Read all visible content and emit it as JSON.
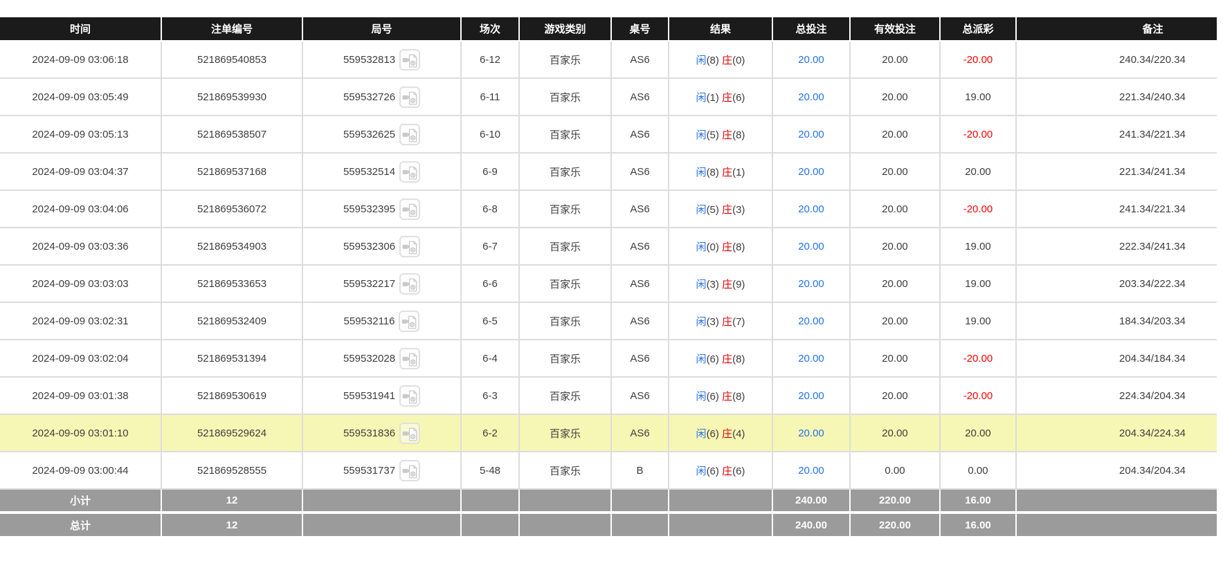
{
  "table": {
    "columns": [
      {
        "label": "时间"
      },
      {
        "label": "注单编号"
      },
      {
        "label": "局号"
      },
      {
        "label": "场次"
      },
      {
        "label": "游戏类别"
      },
      {
        "label": "桌号"
      },
      {
        "label": "结果"
      },
      {
        "label": "总投注"
      },
      {
        "label": "有效投注"
      },
      {
        "label": "总派彩"
      },
      {
        "label": "备注"
      }
    ],
    "rows": [
      {
        "time": "2024-09-09 03:06:18",
        "bet_id": "521869540853",
        "round_id": "559532813",
        "session": "6-12",
        "game": "百家乐",
        "table_no": "AS6",
        "player": "闲",
        "player_val": "(8)",
        "banker": "庄",
        "banker_val": "(0)",
        "total_bet": "20.00",
        "valid_bet": "20.00",
        "payout": "-20.00",
        "payout_neg": true,
        "remark": "240.34/220.34",
        "highlighted": false
      },
      {
        "time": "2024-09-09 03:05:49",
        "bet_id": "521869539930",
        "round_id": "559532726",
        "session": "6-11",
        "game": "百家乐",
        "table_no": "AS6",
        "player": "闲",
        "player_val": "(1)",
        "banker": "庄",
        "banker_val": "(6)",
        "total_bet": "20.00",
        "valid_bet": "20.00",
        "payout": "19.00",
        "payout_neg": false,
        "remark": "221.34/240.34",
        "highlighted": false
      },
      {
        "time": "2024-09-09 03:05:13",
        "bet_id": "521869538507",
        "round_id": "559532625",
        "session": "6-10",
        "game": "百家乐",
        "table_no": "AS6",
        "player": "闲",
        "player_val": "(5)",
        "banker": "庄",
        "banker_val": "(8)",
        "total_bet": "20.00",
        "valid_bet": "20.00",
        "payout": "-20.00",
        "payout_neg": true,
        "remark": "241.34/221.34",
        "highlighted": false
      },
      {
        "time": "2024-09-09 03:04:37",
        "bet_id": "521869537168",
        "round_id": "559532514",
        "session": "6-9",
        "game": "百家乐",
        "table_no": "AS6",
        "player": "闲",
        "player_val": "(8)",
        "banker": "庄",
        "banker_val": "(1)",
        "total_bet": "20.00",
        "valid_bet": "20.00",
        "payout": "20.00",
        "payout_neg": false,
        "remark": "221.34/241.34",
        "highlighted": false
      },
      {
        "time": "2024-09-09 03:04:06",
        "bet_id": "521869536072",
        "round_id": "559532395",
        "session": "6-8",
        "game": "百家乐",
        "table_no": "AS6",
        "player": "闲",
        "player_val": "(5)",
        "banker": "庄",
        "banker_val": "(3)",
        "total_bet": "20.00",
        "valid_bet": "20.00",
        "payout": "-20.00",
        "payout_neg": true,
        "remark": "241.34/221.34",
        "highlighted": false
      },
      {
        "time": "2024-09-09 03:03:36",
        "bet_id": "521869534903",
        "round_id": "559532306",
        "session": "6-7",
        "game": "百家乐",
        "table_no": "AS6",
        "player": "闲",
        "player_val": "(0)",
        "banker": "庄",
        "banker_val": "(8)",
        "total_bet": "20.00",
        "valid_bet": "20.00",
        "payout": "19.00",
        "payout_neg": false,
        "remark": "222.34/241.34",
        "highlighted": false
      },
      {
        "time": "2024-09-09 03:03:03",
        "bet_id": "521869533653",
        "round_id": "559532217",
        "session": "6-6",
        "game": "百家乐",
        "table_no": "AS6",
        "player": "闲",
        "player_val": "(3)",
        "banker": "庄",
        "banker_val": "(9)",
        "total_bet": "20.00",
        "valid_bet": "20.00",
        "payout": "19.00",
        "payout_neg": false,
        "remark": "203.34/222.34",
        "highlighted": false
      },
      {
        "time": "2024-09-09 03:02:31",
        "bet_id": "521869532409",
        "round_id": "559532116",
        "session": "6-5",
        "game": "百家乐",
        "table_no": "AS6",
        "player": "闲",
        "player_val": "(3)",
        "banker": "庄",
        "banker_val": "(7)",
        "total_bet": "20.00",
        "valid_bet": "20.00",
        "payout": "19.00",
        "payout_neg": false,
        "remark": "184.34/203.34",
        "highlighted": false
      },
      {
        "time": "2024-09-09 03:02:04",
        "bet_id": "521869531394",
        "round_id": "559532028",
        "session": "6-4",
        "game": "百家乐",
        "table_no": "AS6",
        "player": "闲",
        "player_val": "(6)",
        "banker": "庄",
        "banker_val": "(8)",
        "total_bet": "20.00",
        "valid_bet": "20.00",
        "payout": "-20.00",
        "payout_neg": true,
        "remark": "204.34/184.34",
        "highlighted": false
      },
      {
        "time": "2024-09-09 03:01:38",
        "bet_id": "521869530619",
        "round_id": "559531941",
        "session": "6-3",
        "game": "百家乐",
        "table_no": "AS6",
        "player": "闲",
        "player_val": "(6)",
        "banker": "庄",
        "banker_val": "(8)",
        "total_bet": "20.00",
        "valid_bet": "20.00",
        "payout": "-20.00",
        "payout_neg": true,
        "remark": "224.34/204.34",
        "highlighted": false
      },
      {
        "time": "2024-09-09 03:01:10",
        "bet_id": "521869529624",
        "round_id": "559531836",
        "session": "6-2",
        "game": "百家乐",
        "table_no": "AS6",
        "player": "闲",
        "player_val": "(6)",
        "banker": "庄",
        "banker_val": "(4)",
        "total_bet": "20.00",
        "valid_bet": "20.00",
        "payout": "20.00",
        "payout_neg": false,
        "remark": "204.34/224.34",
        "highlighted": true
      },
      {
        "time": "2024-09-09 03:00:44",
        "bet_id": "521869528555",
        "round_id": "559531737",
        "session": "5-48",
        "game": "百家乐",
        "table_no": "B",
        "player": "闲",
        "player_val": "(6)",
        "banker": "庄",
        "banker_val": "(6)",
        "total_bet": "20.00",
        "valid_bet": "0.00",
        "payout": "0.00",
        "payout_neg": false,
        "remark": "204.34/204.34",
        "highlighted": false
      }
    ],
    "subtotal": {
      "label": "小计",
      "count": "12",
      "total_bet": "240.00",
      "valid_bet": "220.00",
      "payout": "16.00"
    },
    "total": {
      "label": "总计",
      "count": "12",
      "total_bet": "240.00",
      "valid_bet": "220.00",
      "payout": "16.00"
    }
  },
  "icons": {
    "video_replay": "video-film-document"
  },
  "colors": {
    "header_bg": "#1b1b1b",
    "row_highlight": "#f7f7b5",
    "summary_bg": "#9b9b9b",
    "player_blue": "#2472e8",
    "banker_red": "#dd0000",
    "payout_negative_red": "#fe0000"
  }
}
